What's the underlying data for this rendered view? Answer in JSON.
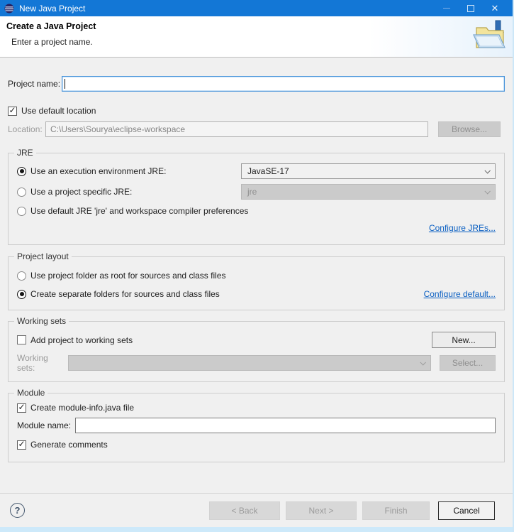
{
  "window": {
    "title": "New Java Project",
    "controls": {
      "minimize": "minimize",
      "maximize": "maximize",
      "close": "✕"
    }
  },
  "header": {
    "title": "Create a Java Project",
    "subtitle": "Enter a project name.",
    "icon": "new-java-project-folder"
  },
  "form": {
    "project_name": {
      "label": "Project name:",
      "value": "",
      "placeholder": ""
    },
    "use_default_location": {
      "label": "Use default location",
      "checked": true
    },
    "location": {
      "label": "Location:",
      "value": "C:\\Users\\Sourya\\eclipse-workspace",
      "browse_label": "Browse..."
    },
    "jre": {
      "legend": "JRE",
      "options": [
        {
          "label": "Use an execution environment JRE:",
          "selected": true
        },
        {
          "label": "Use a project specific JRE:",
          "selected": false
        },
        {
          "label": "Use default JRE 'jre' and workspace compiler preferences",
          "selected": false
        }
      ],
      "execution_env_value": "JavaSE-17",
      "project_jre_value": "jre",
      "configure_link": "Configure JREs..."
    },
    "project_layout": {
      "legend": "Project layout",
      "options": [
        {
          "label": "Use project folder as root for sources and class files",
          "selected": false
        },
        {
          "label": "Create separate folders for sources and class files",
          "selected": true
        }
      ],
      "configure_link": "Configure default..."
    },
    "working_sets": {
      "legend": "Working sets",
      "add_checkbox": {
        "label": "Add project to working sets",
        "checked": false
      },
      "new_button": "New...",
      "sets_label": "Working sets:",
      "sets_value": "",
      "select_button": "Select..."
    },
    "module": {
      "legend": "Module",
      "create_info": {
        "label": "Create module-info.java file",
        "checked": true
      },
      "name_label": "Module name:",
      "name_value": "",
      "generate_comments": {
        "label": "Generate comments",
        "checked": true
      }
    }
  },
  "footer": {
    "help": "?",
    "back": "< Back",
    "next": "Next >",
    "finish": "Finish",
    "cancel": "Cancel"
  },
  "colors": {
    "titlebar": "#1377d6",
    "link": "#0a5fc2",
    "focus_border": "#4a94da",
    "disabled_bg": "#cbcbcb",
    "body_bg": "#f0f0f0",
    "bottom_strip": "#cde9fa"
  }
}
